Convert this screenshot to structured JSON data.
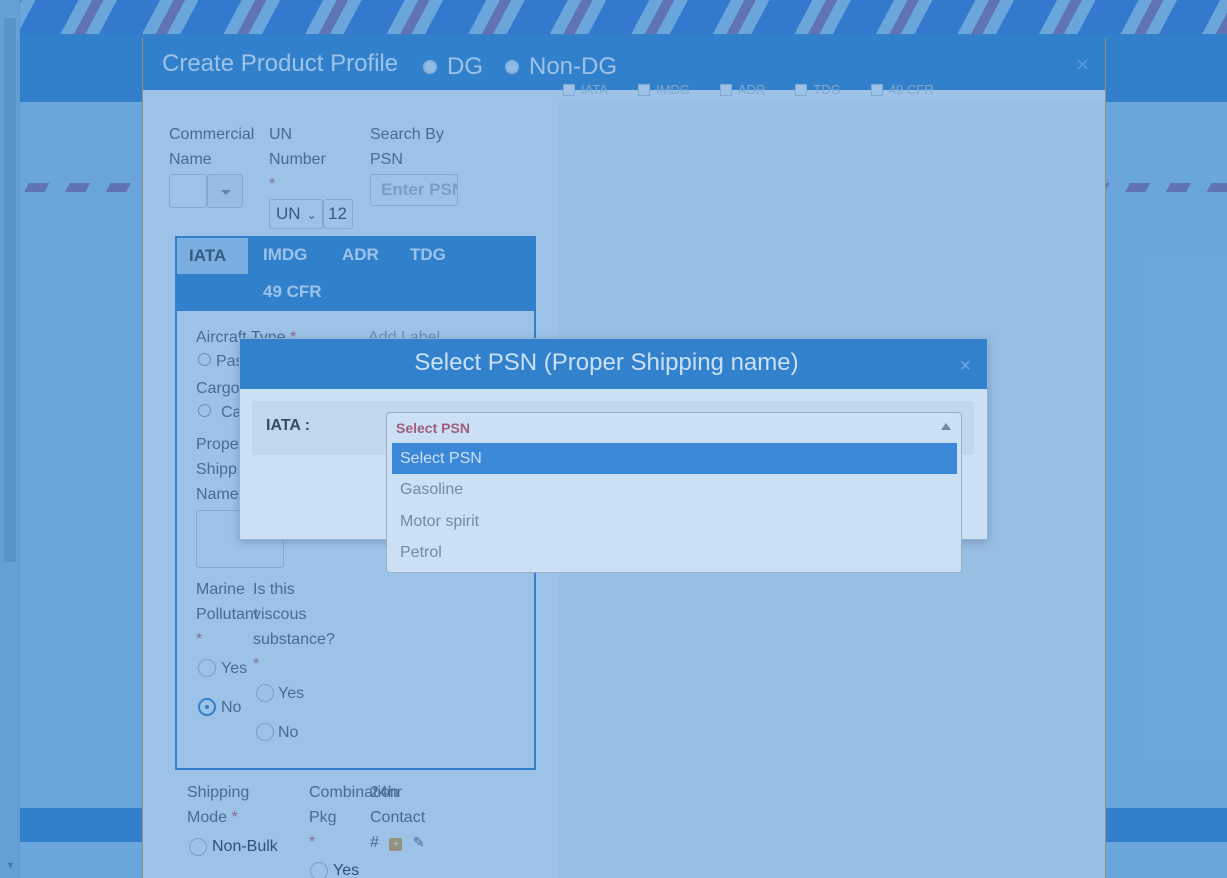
{
  "profile_modal": {
    "title": "Create Product Profile",
    "type_options": [
      "DG",
      "Non-DG"
    ],
    "close": "×",
    "top_checks": [
      "IATA",
      "IMDG",
      "ADR",
      "TDG",
      "49 CFR"
    ],
    "fields": {
      "commercial_name": [
        "Commercial",
        "Name"
      ],
      "un_number": [
        "UN",
        "Number"
      ],
      "un_prefix": "UN",
      "un_value": "12",
      "search_psn": [
        "Search By",
        "PSN"
      ],
      "search_psn_placeholder": "Enter PSN",
      "required_mark": "*"
    },
    "tabs": [
      "IATA",
      "IMDG",
      "ADR",
      "TDG",
      "49 CFR"
    ],
    "iata": {
      "aircraft_type": "Aircraft Type",
      "add_label": "Add Label",
      "passenger": "Pas",
      "cargo_label": "Cargo",
      "cargo": "Ca",
      "proper_shipping_name": [
        "Prope",
        "Shipp",
        "Name"
      ],
      "marine_pollutant": [
        "Marine",
        "Pollutant"
      ],
      "viscous": [
        "Is this",
        "viscous",
        "substance?"
      ],
      "yes": "Yes",
      "no": "No"
    },
    "bottom": {
      "shipping_mode": [
        "Shipping",
        "Mode"
      ],
      "non_bulk": "Non-Bulk",
      "combination_pkg": [
        "Combination",
        "Pkg"
      ],
      "contact_24hr": [
        "24hr",
        "Contact",
        "#"
      ],
      "yes": "Yes"
    }
  },
  "psn_modal": {
    "title": "Select PSN (Proper Shipping name)",
    "close": "×",
    "label": "IATA :",
    "selected": "Select PSN",
    "options": [
      "Select PSN",
      "Gasoline",
      "Motor spirit",
      "Petrol"
    ],
    "highlighted_index": 0
  },
  "colors": {
    "header_blue": "#2b7cc9",
    "select_value": "#c44b5a",
    "highlight": "#3a85d8"
  }
}
